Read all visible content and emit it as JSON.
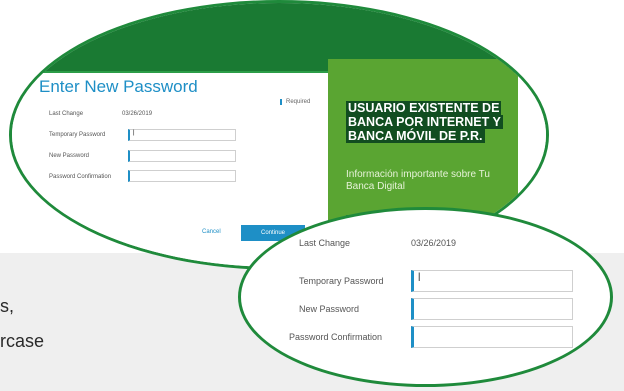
{
  "background": {
    "line1": "s,",
    "line2": "rcase"
  },
  "form": {
    "title": "Enter New Password",
    "required_label": "Required",
    "last_change_label": "Last Change",
    "last_change_value": "03/26/2019",
    "temporary_password_label": "Temporary Password",
    "temporary_password_value": "|",
    "new_password_label": "New Password",
    "new_password_value": "",
    "password_confirmation_label": "Password Confirmation",
    "password_confirmation_value": "",
    "cancel_label": "Cancel",
    "continue_label": "Continue"
  },
  "promo": {
    "title": "USUARIO EXISTENTE DE BANCA POR INTERNET Y BANCA MÓVIL DE P.R.",
    "subtitle": "Información importante sobre Tu Banca Digital"
  },
  "zoom": {
    "last_change_label": "Last Change",
    "last_change_value": "03/26/2019",
    "temporary_password_label": "Temporary Password",
    "temporary_password_value": "|",
    "new_password_label": "New Password",
    "new_password_value": "",
    "password_confirmation_label": "Password Confirmation",
    "password_confirmation_value": ""
  },
  "colors": {
    "brand_green": "#1a7a33",
    "promo_green": "#5aa532",
    "accent_blue": "#1e8fc6"
  }
}
